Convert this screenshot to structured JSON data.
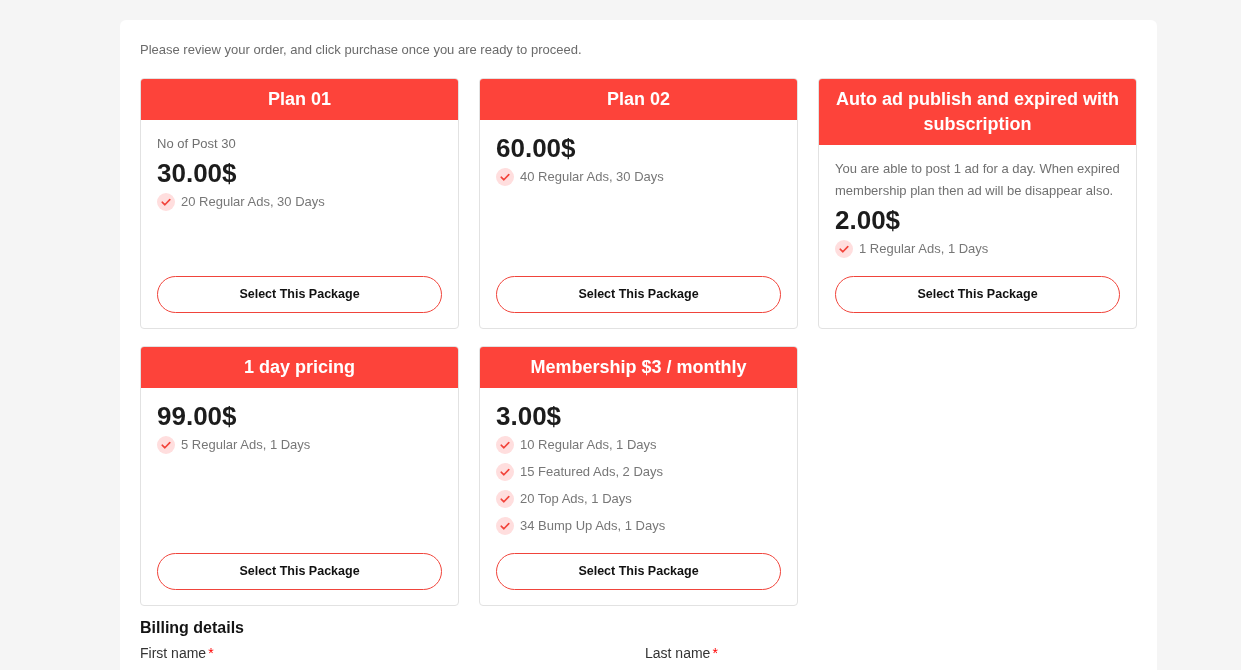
{
  "intro": "Please review your order, and click purchase once you are ready to proceed.",
  "packages": [
    {
      "title": "Plan 01",
      "description": "No of Post 30",
      "price": "30.00$",
      "features": [
        "20 Regular Ads, 30 Days"
      ],
      "button": "Select This Package"
    },
    {
      "title": "Plan 02",
      "price": "60.00$",
      "features": [
        "40 Regular Ads, 30 Days"
      ],
      "button": "Select This Package"
    },
    {
      "title": "Auto ad publish and expired with subscription",
      "description": "You are able to post 1 ad for a day. When expired membership plan then ad will be disappear also.",
      "price": "2.00$",
      "features": [
        "1 Regular Ads, 1 Days"
      ],
      "button": "Select This Package"
    },
    {
      "title": "1 day pricing",
      "price": "99.00$",
      "features": [
        "5 Regular Ads, 1 Days"
      ],
      "button": "Select This Package"
    },
    {
      "title": "Membership $3 / monthly",
      "price": "3.00$",
      "features": [
        "10 Regular Ads, 1 Days",
        "15 Featured Ads, 2 Days",
        "20 Top Ads, 1 Days",
        "34 Bump Up Ads, 1 Days"
      ],
      "button": "Select This Package"
    }
  ],
  "billing": {
    "heading": "Billing details",
    "fields": [
      {
        "label": "First name",
        "required_mark": "*"
      },
      {
        "label": "Last name",
        "required_mark": "*"
      }
    ]
  }
}
